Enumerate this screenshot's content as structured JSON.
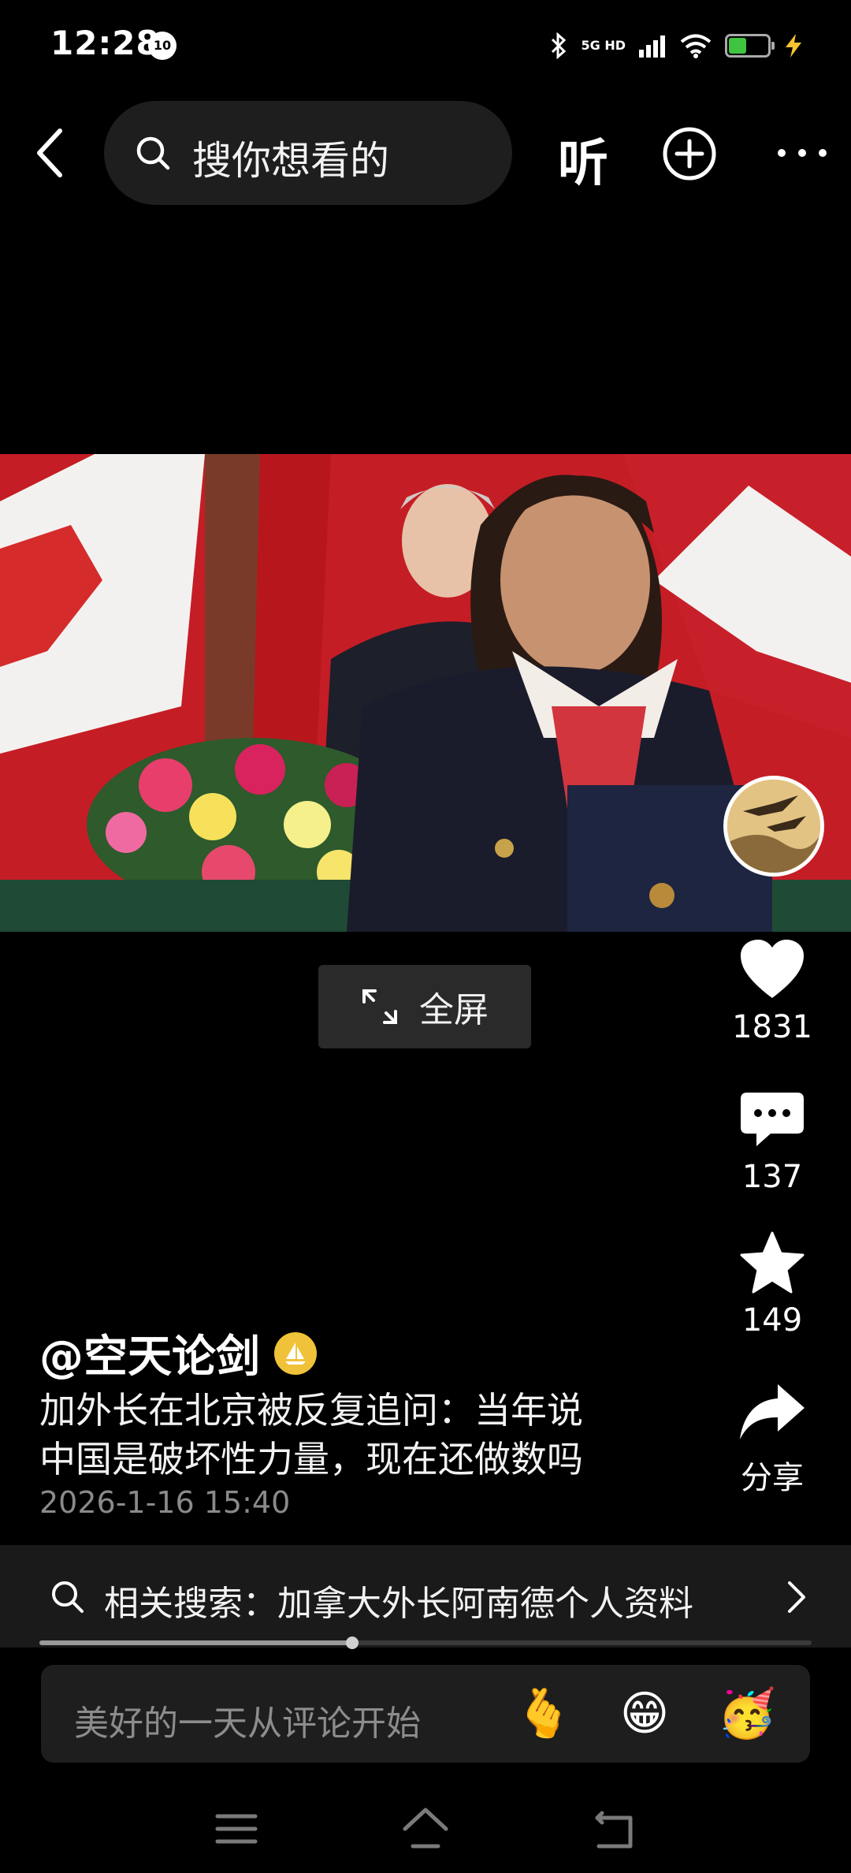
{
  "status_bar": {
    "time": "12:28",
    "badge": "10",
    "network": "5G HD",
    "battery_level": 0.45
  },
  "top_nav": {
    "search_placeholder": "搜你想看的",
    "listen_label": "听"
  },
  "video": {
    "fullscreen_label": "全屏"
  },
  "actions": {
    "like_count": "1831",
    "comment_count": "137",
    "favorite_count": "149",
    "share_label": "分享"
  },
  "post": {
    "author": "@空天论剑",
    "title_line1": "加外长在北京被反复追问：当年说",
    "title_line2": "中国是破坏性力量，现在还做数吗",
    "date": "2026-1-16 15:40"
  },
  "related_search": {
    "text": "相关搜索：加拿大外长阿南德个人资料"
  },
  "playback": {
    "progress": 0.405
  },
  "comment_input": {
    "placeholder": "美好的一天从评论开始",
    "emojis": [
      "🫰",
      "😁",
      "🥳"
    ]
  },
  "colors": {
    "background": "#000000",
    "surface": "#1e1e1e",
    "text": "#ffffff",
    "muted": "#8a8a8a",
    "verified": "#f0c23a",
    "battery": "#3ec43e"
  }
}
